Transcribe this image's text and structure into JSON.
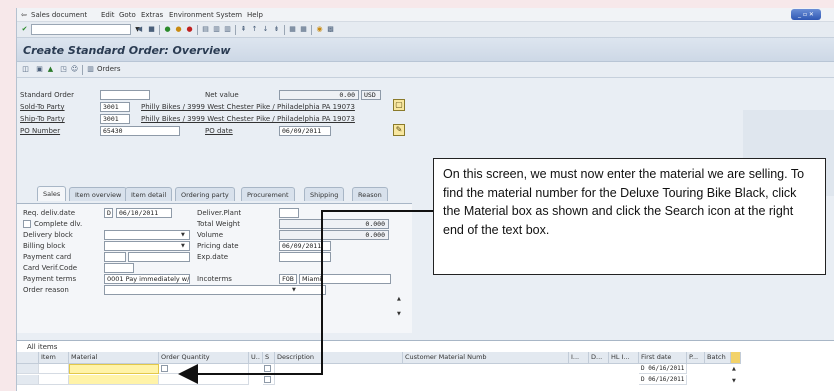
{
  "menu": {
    "items": [
      "Sales document",
      "Edit",
      "Goto",
      "Extras",
      "Environment",
      "System",
      "Help"
    ],
    "window_controls": "_ ▫ ✕"
  },
  "title": "Create Standard Order: Overview",
  "app_toolbar": {
    "orders_label": "Orders"
  },
  "header": {
    "standard_order_label": "Standard Order",
    "standard_order_value": "",
    "net_value_label": "Net value",
    "net_value": "0.00",
    "currency": "USD",
    "sold_to_label": "Sold-To Party",
    "sold_to_value": "3001",
    "sold_to_desc": "Philly Bikes / 3999 West Chester Pike / Philadelphia PA 19073",
    "ship_to_label": "Ship-To Party",
    "ship_to_value": "3001",
    "ship_to_desc": "Philly Bikes / 3999 West Chester Pike / Philadelphia PA 19073",
    "po_number_label": "PO Number",
    "po_number_value": "65430",
    "po_date_label": "PO date",
    "po_date_value": "06/09/2011"
  },
  "tabs": [
    "Sales",
    "Item overview",
    "Item detail",
    "Ordering party",
    "Procurement",
    "Shipping",
    "Reason"
  ],
  "sales_tab": {
    "req_deliv_date_label": "Req. deliv.date",
    "req_deliv_date_prefix": "D",
    "req_deliv_date_value": "06/10/2011",
    "deliver_plant_label": "Deliver.Plant",
    "complete_dlv_label": "Complete dlv.",
    "total_weight_label": "Total Weight",
    "total_weight_value": "0.000",
    "delivery_block_label": "Delivery block",
    "volume_label": "Volume",
    "volume_value": "0.000",
    "billing_block_label": "Billing block",
    "pricing_date_label": "Pricing date",
    "pricing_date_value": "06/09/2011",
    "payment_card_label": "Payment card",
    "exp_date_label": "Exp.date",
    "card_verif_label": "Card Verif.Code",
    "payment_terms_label": "Payment terms",
    "payment_terms_value": "0001 Pay immediately w/...",
    "incoterms_label": "Incoterms",
    "incoterms_code": "FOB",
    "incoterms_place": "Miami",
    "order_reason_label": "Order reason"
  },
  "items": {
    "caption": "All items",
    "columns": [
      "Item",
      "Material",
      "Order Quantity",
      "U..",
      "S",
      "Description",
      "Customer Material Numb",
      "I...",
      "D...",
      "HL I...",
      "First date",
      "P...",
      "Batch"
    ],
    "rows": [
      {
        "first_date_prefix": "D",
        "first_date": "06/16/2011"
      },
      {
        "first_date_prefix": "D",
        "first_date": "06/16/2011"
      }
    ]
  },
  "callout": {
    "text": "On this screen, we must now enter the material we are selling. To find the material number for the Deluxe Touring Bike Black, click the Material box as shown and click the Search icon at the right end of the text box."
  }
}
